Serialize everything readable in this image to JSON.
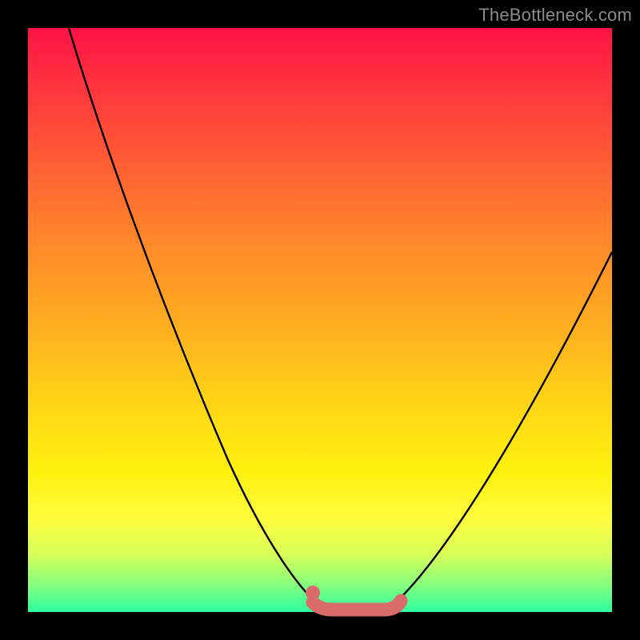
{
  "watermark": "TheBottleneck.com",
  "colors": {
    "background": "#000000",
    "gradient_top": "#ff1246",
    "gradient_mid": "#ffd715",
    "gradient_bottom": "#2bffa0",
    "curve": "#000000",
    "flat_marker": "#da6b6b"
  },
  "chart_data": {
    "type": "line",
    "title": "",
    "xlabel": "",
    "ylabel": "",
    "xlim": [
      0,
      100
    ],
    "ylim": [
      0,
      100
    ],
    "series": [
      {
        "name": "left-branch",
        "x": [
          7,
          12,
          18,
          24,
          30,
          36,
          42,
          46,
          49
        ],
        "y": [
          100,
          85,
          70,
          56,
          42,
          29,
          17,
          8,
          2
        ]
      },
      {
        "name": "flat-bottom",
        "x": [
          49,
          52,
          55,
          58,
          61,
          63
        ],
        "y": [
          2,
          1,
          1,
          1,
          1,
          2
        ]
      },
      {
        "name": "right-branch",
        "x": [
          63,
          68,
          74,
          80,
          86,
          92,
          100
        ],
        "y": [
          2,
          8,
          17,
          27,
          38,
          49,
          62
        ]
      }
    ],
    "marker": {
      "name": "flat-region-highlight",
      "color": "#da6b6b",
      "x_start": 48,
      "x_end": 63,
      "y": 1.5
    }
  }
}
